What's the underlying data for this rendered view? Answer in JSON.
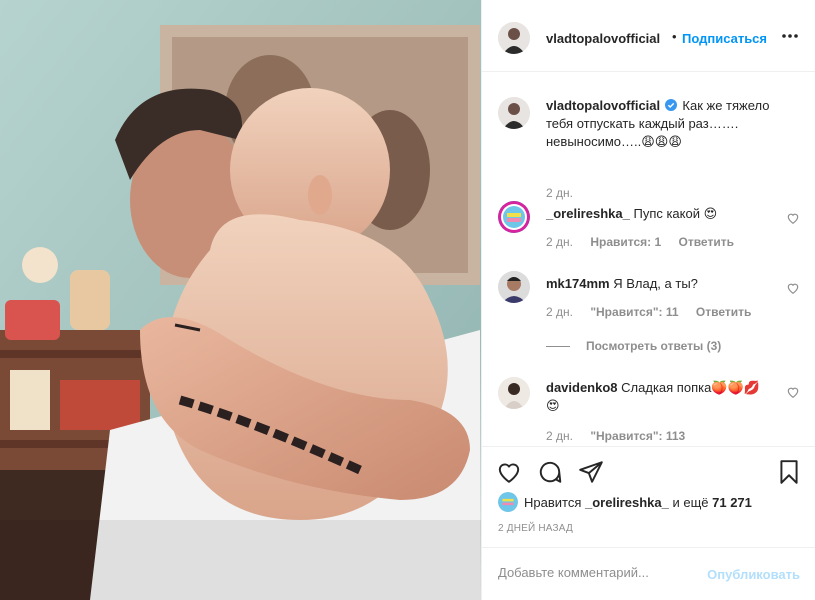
{
  "post": {
    "author": "vladtopalovofficial",
    "dot": "•",
    "follow_label": "Подписаться",
    "more_icon": "more-horizontal-icon",
    "caption": {
      "username": "vladtopalovofficial",
      "text": "Как же тяжело тебя отпускать каждый раз……. невыносимо…..😩😩😩",
      "time": "2 дн."
    },
    "comments": [
      {
        "username": "_orelireshka_",
        "text": "Пупс какой 😍",
        "time": "2 дн.",
        "likes": "Нравится: 1",
        "reply": "Ответить"
      },
      {
        "username": "mk174mm",
        "text": "Я Влад, а ты?",
        "time": "2 дн.",
        "likes": "\"Нравится\": 11",
        "reply": "Ответить",
        "view_replies": "Посмотреть ответы (3)"
      },
      {
        "username": "davidenko8",
        "text": "Сладкая попка🍑🍑💋 😍",
        "time": "2 дн.",
        "likes": "\"Нравится\": 113"
      }
    ],
    "likes": {
      "prefix": "Нравится",
      "user": "_orelireshka_",
      "suffix": "и ещё",
      "count": "71 271"
    },
    "date": "2 дней назад",
    "comment_input": {
      "placeholder": "Добавьте комментарий..."
    },
    "publish_label": "Опубликовать"
  },
  "colors": {
    "accent": "#0095f6",
    "publish_disabled": "#b2dffc",
    "secondary_text": "#8e8e8e",
    "primary_text": "#262626",
    "divider": "#efefef"
  },
  "icons": [
    "heart-icon",
    "comment-icon",
    "share-icon",
    "bookmark-icon",
    "verified-badge-icon"
  ]
}
